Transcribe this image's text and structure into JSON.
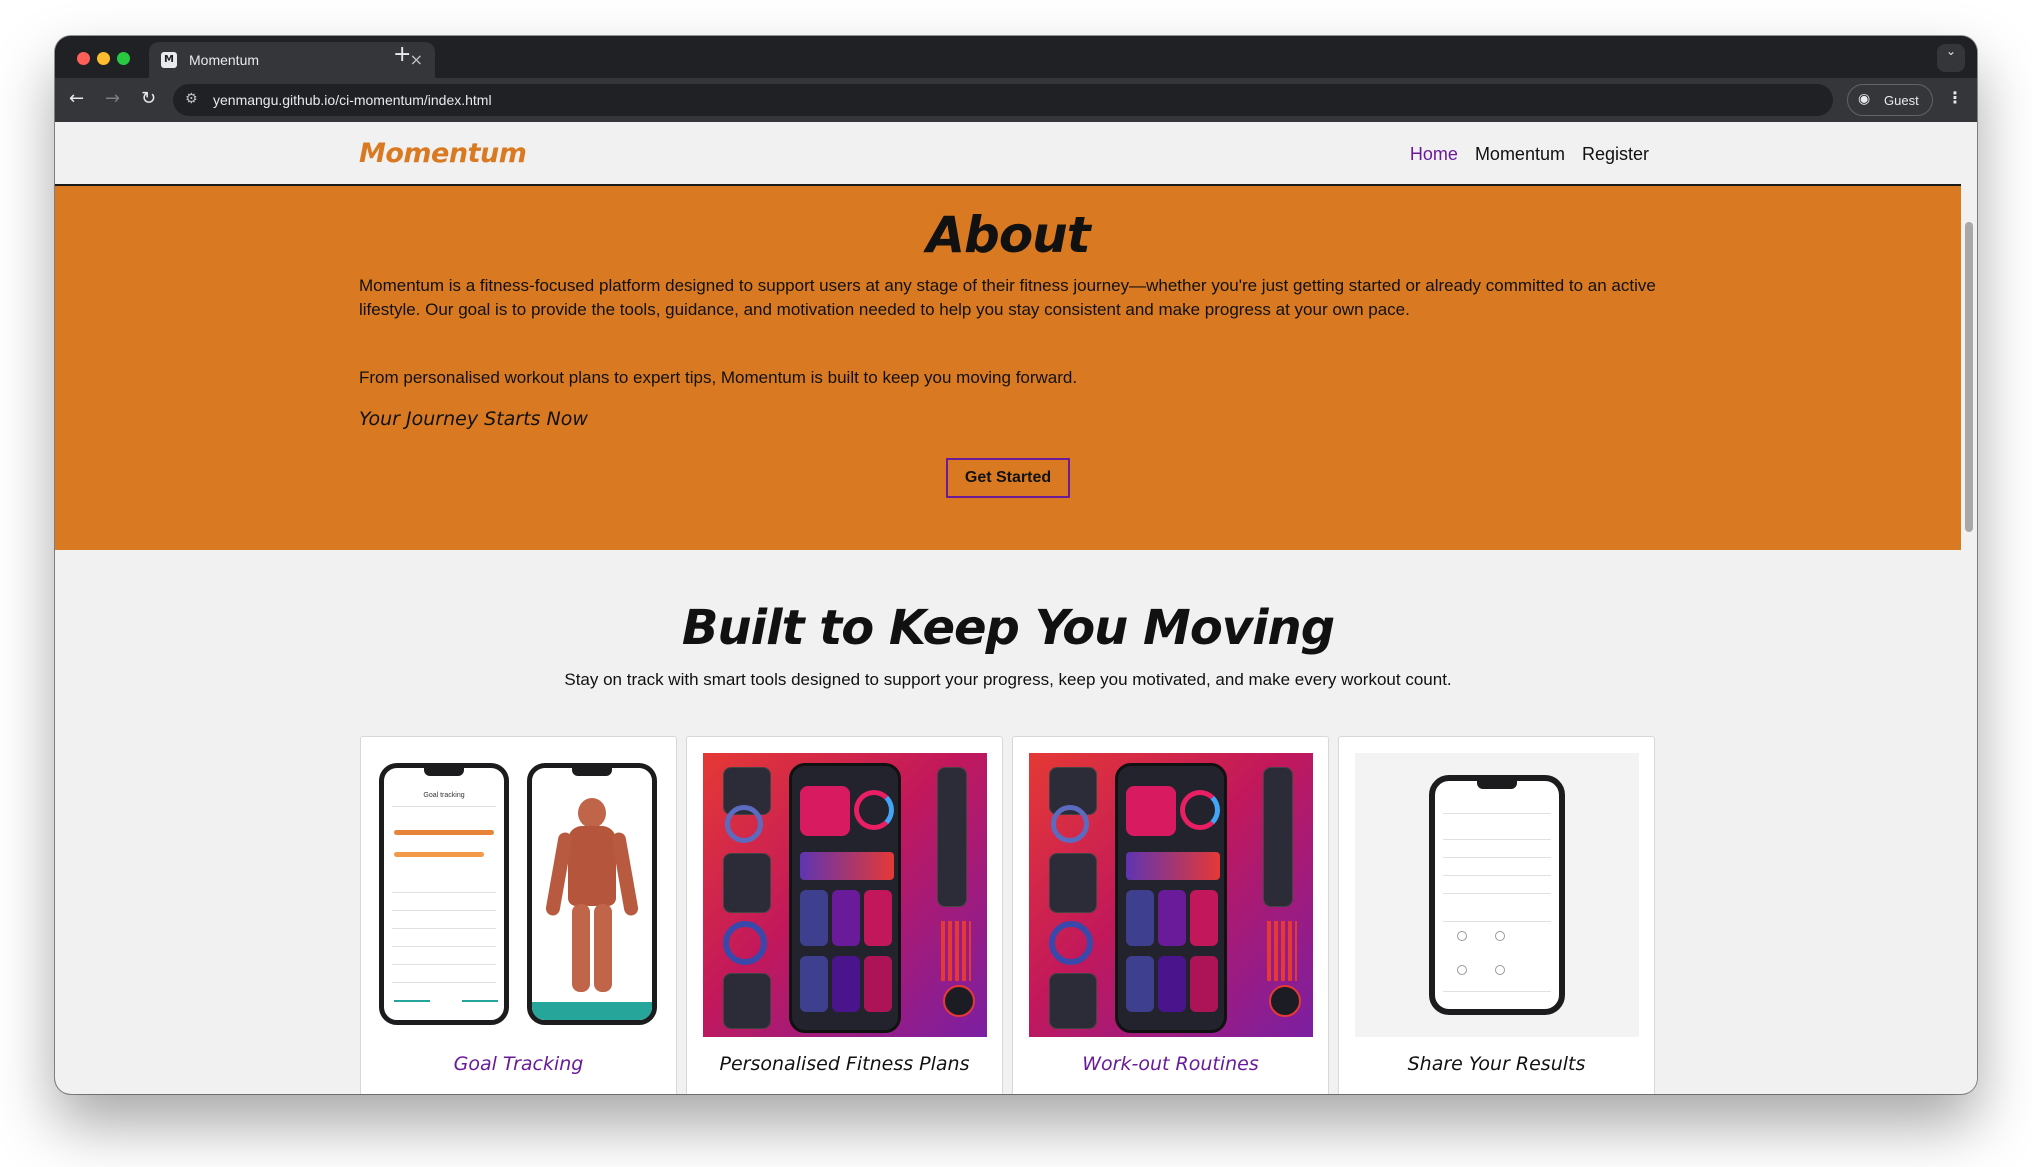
{
  "browser": {
    "tab_title": "Momentum",
    "tab_favicon": "M",
    "url": "yenmangu.github.io/ci-momentum/index.html",
    "profile_label": "Guest",
    "icons": [
      "back-icon",
      "forward-icon",
      "reload-icon",
      "site-settings-icon",
      "profile-icon",
      "menu-icon",
      "close-icon",
      "plus-icon",
      "chevron-down-icon"
    ]
  },
  "nav": {
    "brand": "Momentum",
    "links": [
      {
        "label": "Home",
        "active": true
      },
      {
        "label": "Momentum",
        "active": false
      },
      {
        "label": "Register",
        "active": false
      }
    ]
  },
  "about": {
    "heading": "About",
    "paragraph1": "Momentum is a fitness-focused platform designed to support users at any stage of their fitness journey—whether you're just getting started or already committed to an active lifestyle. Our goal is to provide the tools, guidance, and motivation needed to help you stay consistent and make progress at your own pace.",
    "paragraph2": "From personalised workout plans to expert tips, Momentum is built to keep you moving forward.",
    "tagline": "Your Journey Starts Now",
    "cta_label": "Get Started"
  },
  "features": {
    "heading": "Built to Keep You Moving",
    "subheading": "Stay on track with smart tools designed to support your progress, keep you motivated, and make every workout count.",
    "cards": [
      {
        "title": "Goal Tracking",
        "color": "purple"
      },
      {
        "title": "Personalised Fitness Plans",
        "color": "black"
      },
      {
        "title": "Work-out Routines",
        "color": "purple"
      },
      {
        "title": "Share Your Results",
        "color": "black"
      }
    ]
  },
  "colors": {
    "brand_orange": "#d97a22",
    "accent_purple": "#6a1b9a",
    "page_bg": "#f1f1f1"
  }
}
